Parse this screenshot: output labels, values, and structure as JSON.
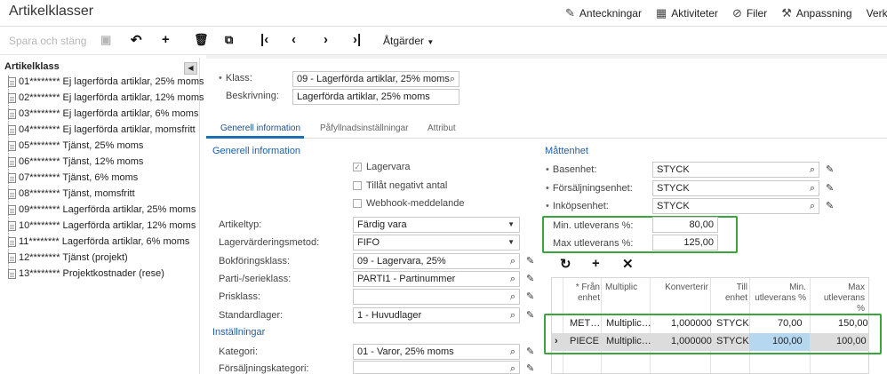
{
  "title": "Artikelklasser",
  "top_links": [
    {
      "label": "Anteckningar",
      "icon": "edit-note-icon"
    },
    {
      "label": "Aktiviteter",
      "icon": "calendar-icon"
    },
    {
      "label": "Filer",
      "icon": "paperclip-icon"
    },
    {
      "label": "Anpassning",
      "icon": "customization-icon"
    },
    {
      "label": "Verktyg",
      "icon": ""
    }
  ],
  "toolbar": {
    "save_close": "Spara och stäng",
    "actions": "Åtgärder"
  },
  "tree": {
    "header": "Artikelklass",
    "items": [
      "01******** Ej lagerförda artiklar, 25% moms",
      "02******** Ej lagerförda artiklar, 12% moms",
      "03******** Ej lagerförda artiklar, 6% moms",
      "04******** Ej lagerförda artiklar, momsfritt",
      "05******** Tjänst, 25% moms",
      "06******** Tjänst, 12% moms",
      "07******** Tjänst, 6% moms",
      "08******** Tjänst, momsfritt",
      "09******** Lagerförda artiklar, 25% moms",
      "10******** Lagerförda artiklar, 12% moms",
      "11******** Lagerförda artiklar, 6% moms",
      "12******** Tjänst (projekt)",
      "13******** Projektkostnader (rese)"
    ]
  },
  "header_form": {
    "class_label": "Klass:",
    "class_value": "09 - Lagerförda artiklar, 25% moms",
    "desc_label": "Beskrivning:",
    "desc_value": "Lagerförda artiklar, 25% moms"
  },
  "tabs": [
    "Generell information",
    "Påfyllnadsinställningar",
    "Attribut"
  ],
  "general": {
    "section": "Generell information",
    "checkboxes": [
      {
        "label": "Lagervara",
        "checked": true
      },
      {
        "label": "Tillåt negativt antal",
        "checked": false
      },
      {
        "label": "Webhook-meddelande",
        "checked": false
      }
    ],
    "fields": [
      {
        "label": "Artikeltyp:",
        "value": "Färdig vara"
      },
      {
        "label": "Lagervärderingsmetod:",
        "value": "FIFO"
      },
      {
        "label": "Bokföringsklass:",
        "value": "09 - Lagervara, 25%"
      },
      {
        "label": "Parti-/serieklass:",
        "value": "PARTI1 - Partinummer"
      },
      {
        "label": "Prisklass:",
        "value": ""
      },
      {
        "label": "Standardlager:",
        "value": "1 - Huvudlager"
      }
    ],
    "settings_section": "Inställningar",
    "settings_fields": [
      {
        "label": "Kategori:",
        "value": "01 - Varor, 25% moms"
      },
      {
        "label": "Försäljningskategori:",
        "value": ""
      }
    ]
  },
  "units": {
    "section": "Måttenhet",
    "fields": [
      {
        "label": "Basenhet:",
        "value": "STYCK"
      },
      {
        "label": "Försäljningsenhet:",
        "value": "STYCK"
      },
      {
        "label": "Inköpsenhet:",
        "value": "STYCK"
      }
    ],
    "min_label": "Min. utleverans %:",
    "min_value": "80,00",
    "max_label": "Max utleverans %:",
    "max_value": "125,00"
  },
  "grid": {
    "headers": [
      "* Från enhet",
      "Multiplic",
      "Konverterir",
      "Till enhet",
      "Min. utleverans %",
      "Max utleverans %"
    ],
    "rows": [
      {
        "from": "MET…",
        "mult": "Multiplic…",
        "conv": "1,000000",
        "to": "STYCK",
        "min": "70,00",
        "max": "150,00"
      },
      {
        "from": "PIECE",
        "mult": "Multiplic…",
        "conv": "1,000000",
        "to": "STYCK",
        "min": "100,00",
        "max": "100,00"
      }
    ],
    "selected_marker": "›"
  },
  "colors": {
    "accent": "#1f6fb5",
    "highlight_green": "#3aa53a",
    "cell_highlight": "#b6d7f0"
  }
}
